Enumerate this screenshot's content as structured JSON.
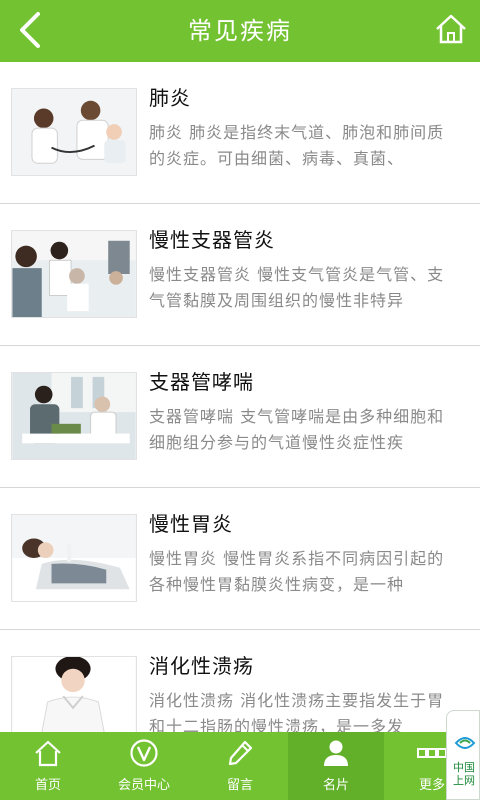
{
  "header": {
    "title": "常见疾病"
  },
  "items": [
    {
      "name": "肺炎",
      "desc": "肺炎 肺炎是指终末气道、肺泡和肺间质的炎症。可由细菌、病毒、真菌、"
    },
    {
      "name": "慢性支器管炎",
      "desc": "慢性支器管炎 慢性支气管炎是气管、支气管黏膜及周围组织的慢性非特异"
    },
    {
      "name": "支器管哮喘",
      "desc": "支器管哮喘 支气管哮喘是由多种细胞和细胞组分参与的气道慢性炎症性疾"
    },
    {
      "name": "慢性胃炎",
      "desc": "慢性胃炎 慢性胃炎系指不同病因引起的各种慢性胃黏膜炎性病变，是一种"
    },
    {
      "name": "消化性溃疡",
      "desc": "消化性溃疡 消化性溃疡主要指发生于胃和十二指肠的慢性溃疡，是一多发"
    }
  ],
  "tabs": [
    {
      "label": "首页",
      "icon": "home-icon"
    },
    {
      "label": "会员中心",
      "icon": "member-v-icon"
    },
    {
      "label": "留言",
      "icon": "pencil-icon"
    },
    {
      "label": "名片",
      "icon": "person-card-icon"
    },
    {
      "label": "更多",
      "icon": "grid-more-icon"
    }
  ],
  "ad": {
    "text": "中国上网"
  },
  "colors": {
    "brand": "#73c232",
    "desc_text": "#8a8a8a"
  }
}
